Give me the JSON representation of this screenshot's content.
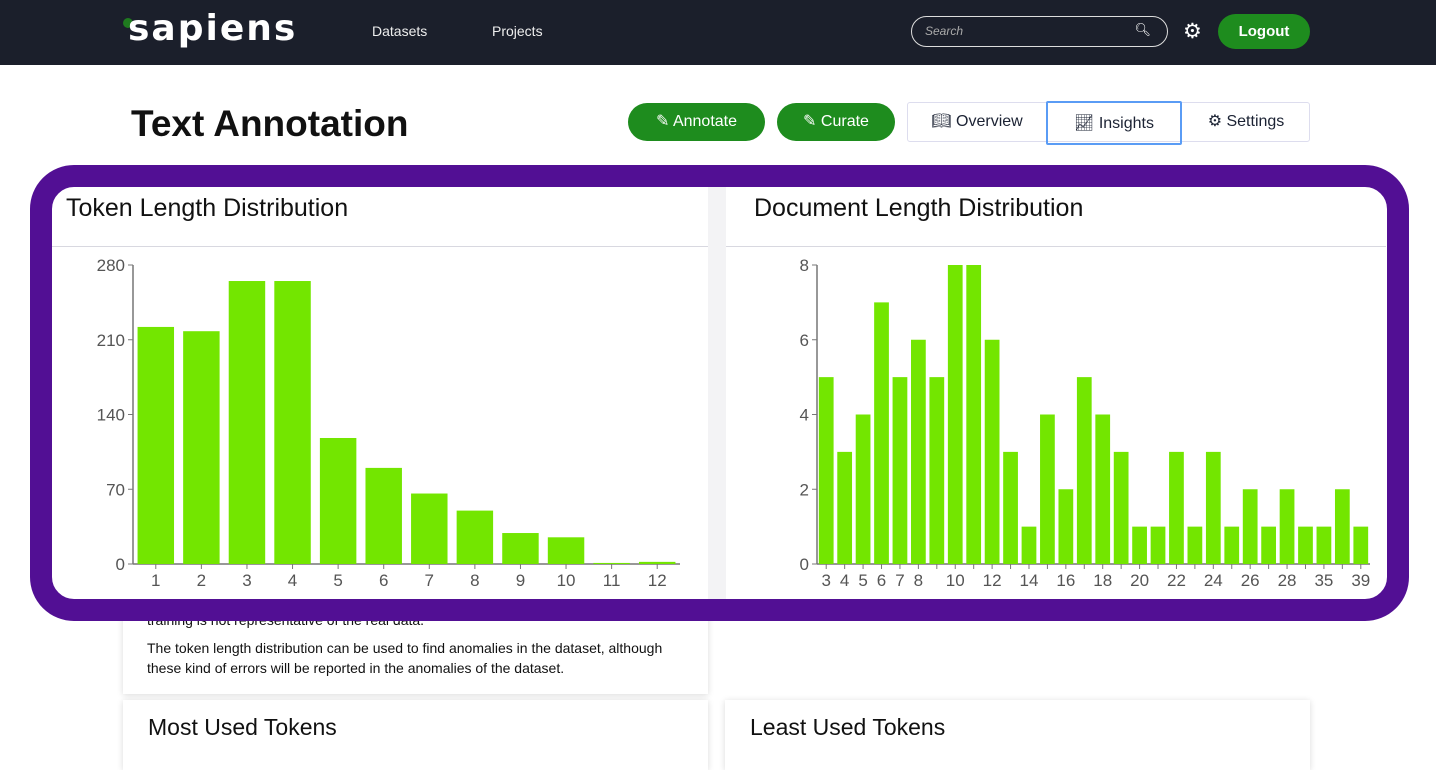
{
  "nav": {
    "logo": "sapiens",
    "links": [
      "Datasets",
      "Projects"
    ],
    "search_placeholder": "Search",
    "search_icon": "magnifier-icon",
    "settings_icon": "gear-icon",
    "logout": "Logout"
  },
  "page": {
    "title": "Text Annotation",
    "annotate": "Annotate",
    "curate": "Curate",
    "tabs": [
      {
        "label": "Overview",
        "icon": "book-icon"
      },
      {
        "label": "Insights",
        "icon": "chart-line-icon",
        "active": true
      },
      {
        "label": "Settings",
        "icon": "gear-icon"
      }
    ]
  },
  "colors": {
    "nav_bg": "#1b1f2b",
    "accent_green": "#1e8c1e",
    "bar": "#73e600",
    "highlight_frame": "#520f94",
    "active_tab_border": "#5a9cf5"
  },
  "token_card": {
    "title": "Token Length Distribution",
    "text_partial": "training is not representative of the real data.",
    "text": "The token length distribution can be used to find anomalies in the dataset, although these kind of errors will be reported in the anomalies of the dataset."
  },
  "document_card": {
    "title": "Document Length Distribution"
  },
  "bottom": {
    "most_used": "Most Used Tokens",
    "least_used": "Least Used Tokens"
  },
  "chart_data": [
    {
      "type": "bar",
      "title": "Token Length Distribution",
      "categories": [
        "1",
        "2",
        "3",
        "4",
        "5",
        "6",
        "7",
        "8",
        "9",
        "10",
        "11",
        "12"
      ],
      "values": [
        222,
        218,
        265,
        265,
        118,
        90,
        66,
        50,
        29,
        25,
        1,
        2
      ],
      "ylim": [
        0,
        280
      ],
      "yticks": [
        0,
        70,
        140,
        210,
        280
      ],
      "grid": false
    },
    {
      "type": "bar",
      "title": "Document Length Distribution",
      "categories": [
        "3",
        "4",
        "5",
        "6",
        "7",
        "8",
        "",
        "10",
        "",
        "12",
        "",
        "14",
        "",
        "16",
        "",
        "18",
        "",
        "20",
        "",
        "22",
        "",
        "24",
        "",
        "26",
        "",
        "28",
        "",
        "35",
        "",
        "39"
      ],
      "values": [
        5,
        3,
        4,
        7,
        5,
        6,
        5,
        8,
        8,
        6,
        3,
        1,
        4,
        2,
        5,
        4,
        3,
        1,
        1,
        3,
        1,
        3,
        1,
        2,
        1,
        2,
        1,
        1,
        2,
        1
      ],
      "ylim": [
        0,
        8
      ],
      "yticks": [
        0,
        2,
        4,
        6,
        8
      ],
      "grid": false
    }
  ]
}
